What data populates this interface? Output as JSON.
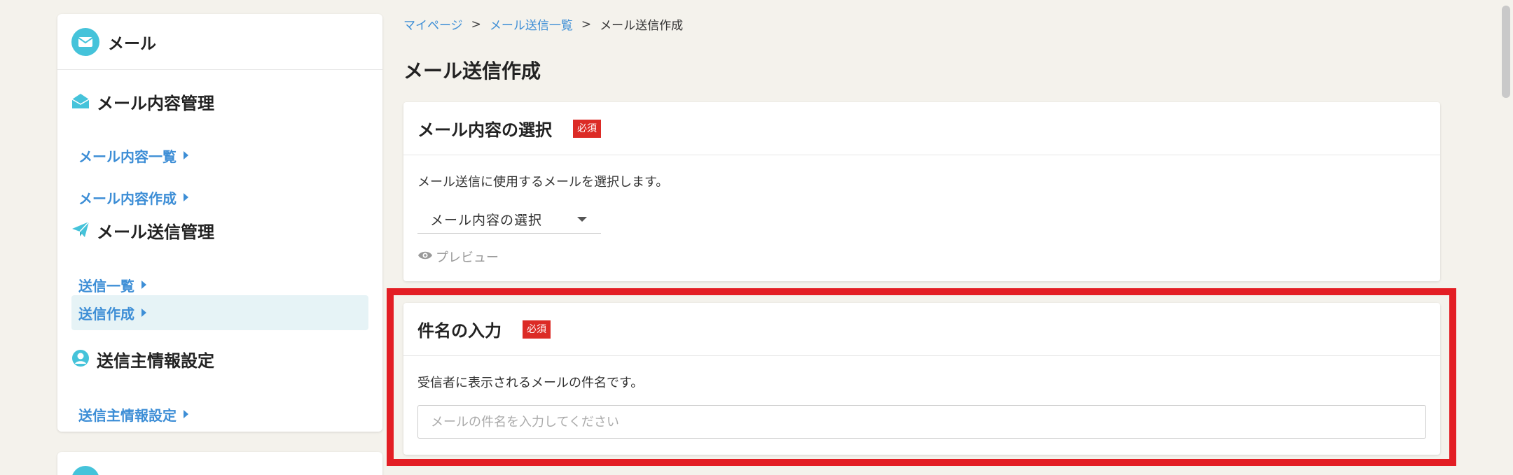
{
  "sidebar": {
    "header_title": "メール",
    "sections": [
      {
        "title": "メール内容管理",
        "icon": "envelope-open-icon"
      },
      {
        "title": "メール送信管理",
        "icon": "paper-plane-icon"
      },
      {
        "title": "送信主情報設定",
        "icon": "user-circle-icon"
      }
    ],
    "links": {
      "mail_content_list": "メール内容一覧",
      "mail_content_create": "メール内容作成",
      "send_list": "送信一覧",
      "send_create": "送信作成",
      "sender_settings": "送信主情報設定"
    },
    "active_link": "send_create"
  },
  "breadcrumb": {
    "items": [
      "マイページ",
      "メール送信一覧",
      "メール送信作成"
    ],
    "separator": ">"
  },
  "page_title": "メール送信作成",
  "card1": {
    "title": "メール内容の選択",
    "badge": "必須",
    "description": "メール送信に使用するメールを選択します。",
    "select_value": "メール内容の選択",
    "preview_label": "プレビュー"
  },
  "card2": {
    "title": "件名の入力",
    "badge": "必須",
    "description": "受信者に表示されるメールの件名です。",
    "input_placeholder": "メールの件名を入力してください",
    "input_value": ""
  },
  "colors": {
    "accent": "#45c3da",
    "link": "#3d8ed6",
    "required_badge": "#dc2b26",
    "highlight": "#e31e24"
  }
}
